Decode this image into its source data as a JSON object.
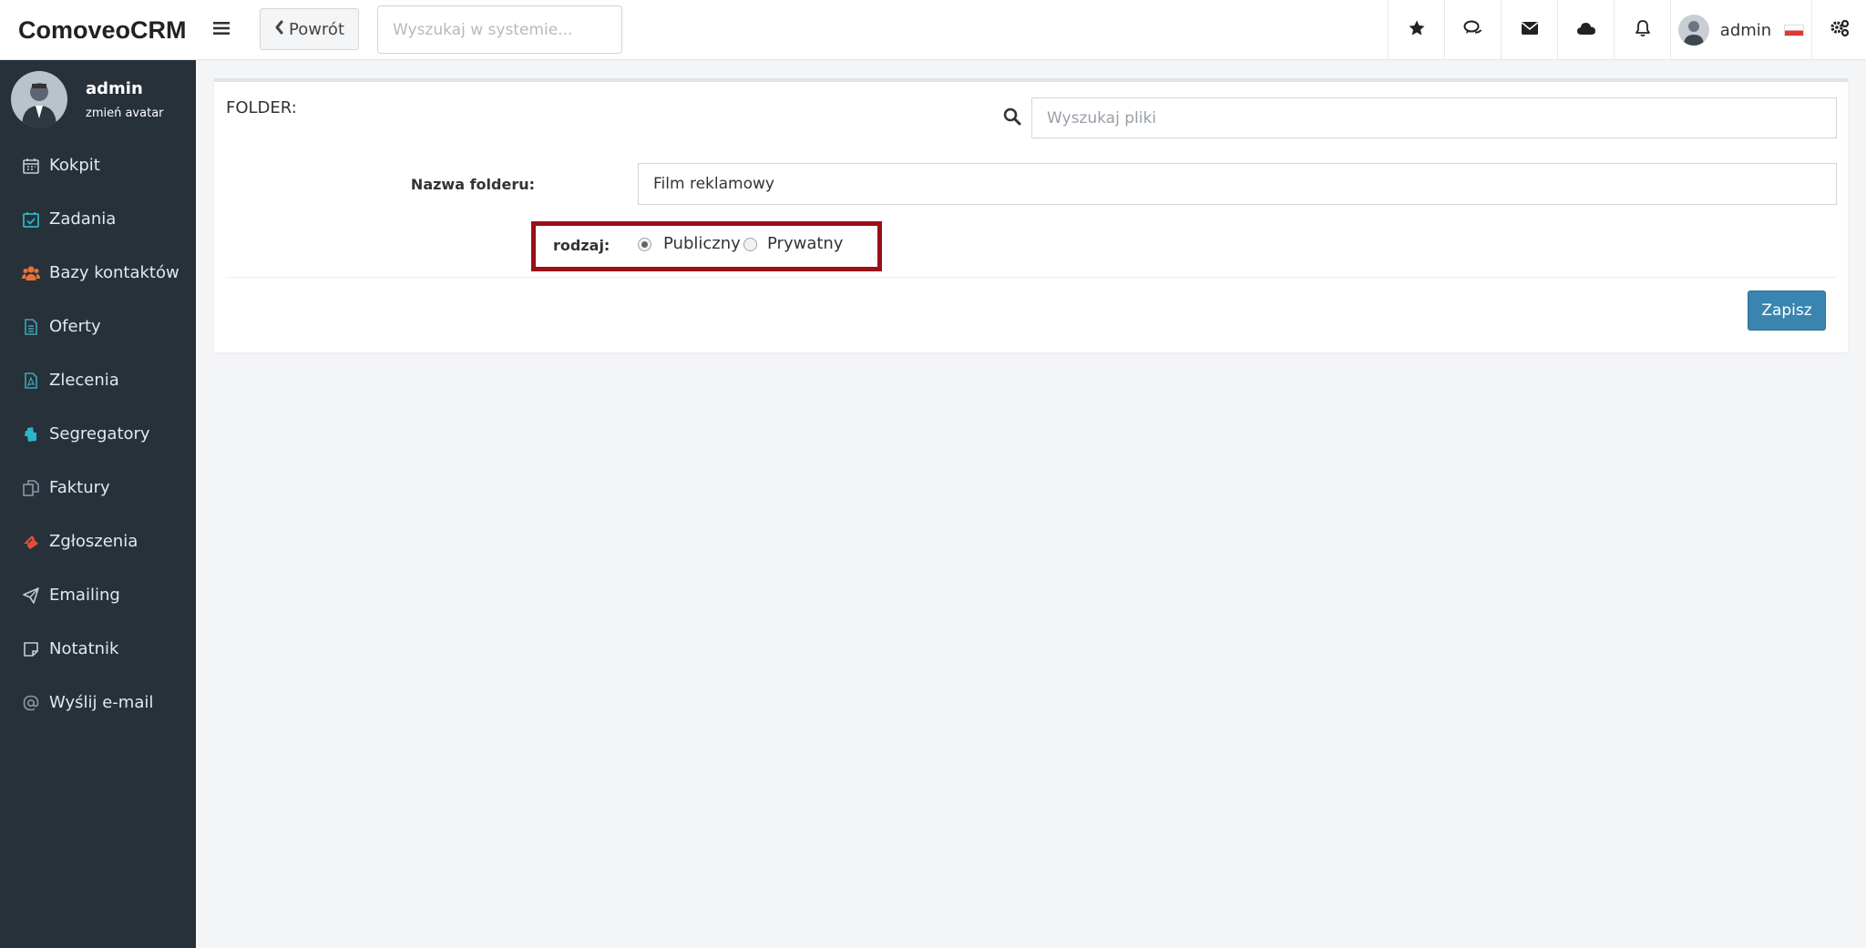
{
  "app": {
    "logo": "ComoveoCRM"
  },
  "header": {
    "back_label": "Powrót",
    "search_placeholder": "Wyszukaj w systemie...",
    "user_name": "admin"
  },
  "sidebar": {
    "profile": {
      "name": "admin",
      "change_avatar": "zmień avatar"
    },
    "items": [
      {
        "label": "Kokpit",
        "icon": "calendar-icon",
        "color": "#c4ccd4"
      },
      {
        "label": "Zadania",
        "icon": "calendar-check-icon",
        "color": "#2bb5c8"
      },
      {
        "label": "Bazy kontaktów",
        "icon": "users-icon",
        "color": "#e8703a"
      },
      {
        "label": "Oferty",
        "icon": "document-icon",
        "color": "#3aa5b5"
      },
      {
        "label": "Zlecenia",
        "icon": "pdf-file-icon",
        "color": "#3aa5b5"
      },
      {
        "label": "Segregatory",
        "icon": "binder-icon",
        "color": "#2bb5c8"
      },
      {
        "label": "Faktury",
        "icon": "copy-icon",
        "color": "#8a96a3"
      },
      {
        "label": "Zgłoszenia",
        "icon": "ticket-icon",
        "color": "#e24d3c"
      },
      {
        "label": "Emailing",
        "icon": "paper-plane-icon",
        "color": "#c4ccd4"
      },
      {
        "label": "Notatnik",
        "icon": "sticky-note-icon",
        "color": "#c4ccd4"
      },
      {
        "label": "Wyślij e-mail",
        "icon": "at-sign-icon",
        "color": "#8a96a3"
      }
    ]
  },
  "form": {
    "folder_label": "FOLDER:",
    "files_search_placeholder": "Wyszukaj pliki",
    "name_label": "Nazwa folderu:",
    "name_value": "Film reklamowy",
    "type_label": "rodzaj:",
    "type_options": [
      {
        "label": "Publiczny",
        "checked": true
      },
      {
        "label": "Prywatny",
        "checked": false
      }
    ],
    "save_label": "Zapisz"
  },
  "colors": {
    "sidebar_bg": "#27313a",
    "primary_button": "#3a85b0",
    "highlight_border": "#9b0f16"
  }
}
